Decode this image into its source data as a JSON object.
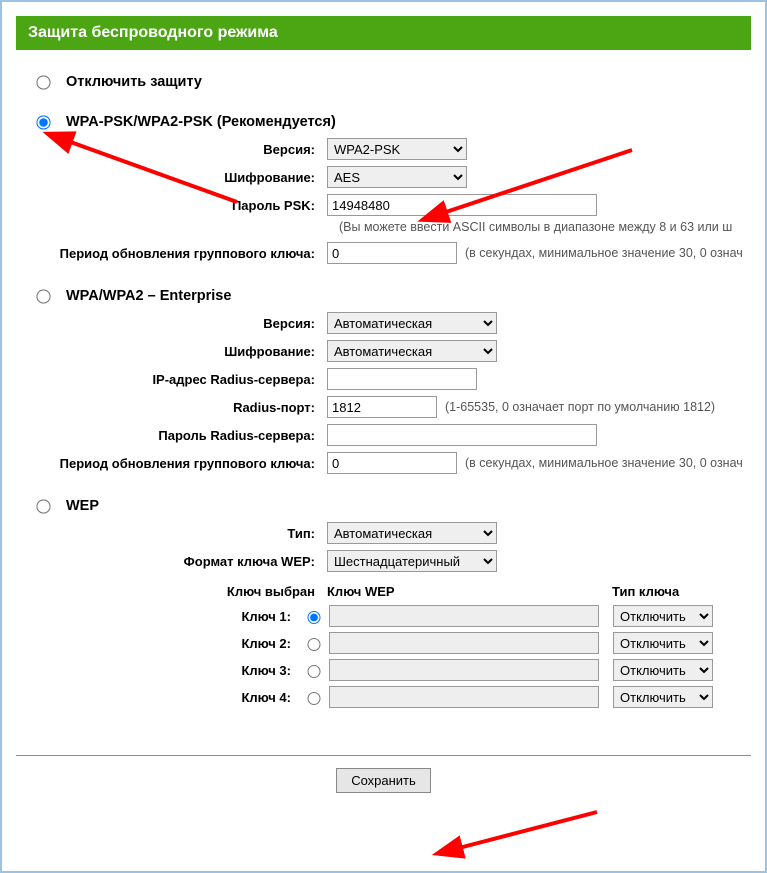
{
  "title": "Защита беспроводного режима",
  "sections": {
    "disable": {
      "label": "Отключить защиту"
    },
    "psk": {
      "label": "WPA-PSK/WPA2-PSK (Рекомендуется)",
      "version_label": "Версия:",
      "version_value": "WPA2-PSK",
      "encryption_label": "Шифрование:",
      "encryption_value": "AES",
      "pass_label": "Пароль PSK:",
      "pass_value": "14948480",
      "pass_hint": "(Вы можете ввести ASCII символы в диапазоне между 8 и 63 или ш",
      "gk_label": "Период обновления группового ключа:",
      "gk_value": "0",
      "gk_hint": "(в секундах, минимальное значение 30, 0 означ"
    },
    "ent": {
      "label": "WPA/WPA2 – Enterprise",
      "version_label": "Версия:",
      "version_value": "Автоматическая",
      "encryption_label": "Шифрование:",
      "encryption_value": "Автоматическая",
      "radius_ip_label": "IP-адрес Radius-сервера:",
      "radius_ip_value": "",
      "radius_port_label": "Radius-порт:",
      "radius_port_value": "1812",
      "radius_port_hint": "(1-65535, 0 означает порт по умолчанию 1812)",
      "radius_pass_label": "Пароль Radius-сервера:",
      "radius_pass_value": "",
      "gk_label": "Период обновления группового ключа:",
      "gk_value": "0",
      "gk_hint": "(в секундах, минимальное значение 30, 0 означ"
    },
    "wep": {
      "label": "WEP",
      "type_label": "Тип:",
      "type_value": "Автоматическая",
      "format_label": "Формат ключа WEP:",
      "format_value": "Шестнадцатеричный",
      "col_selected": "Ключ выбран",
      "col_key": "Ключ WEP",
      "col_type": "Тип ключа",
      "keys": [
        {
          "label": "Ключ 1:",
          "type": "Отключить"
        },
        {
          "label": "Ключ 2:",
          "type": "Отключить"
        },
        {
          "label": "Ключ 3:",
          "type": "Отключить"
        },
        {
          "label": "Ключ 4:",
          "type": "Отключить"
        }
      ]
    }
  },
  "save_label": "Сохранить"
}
